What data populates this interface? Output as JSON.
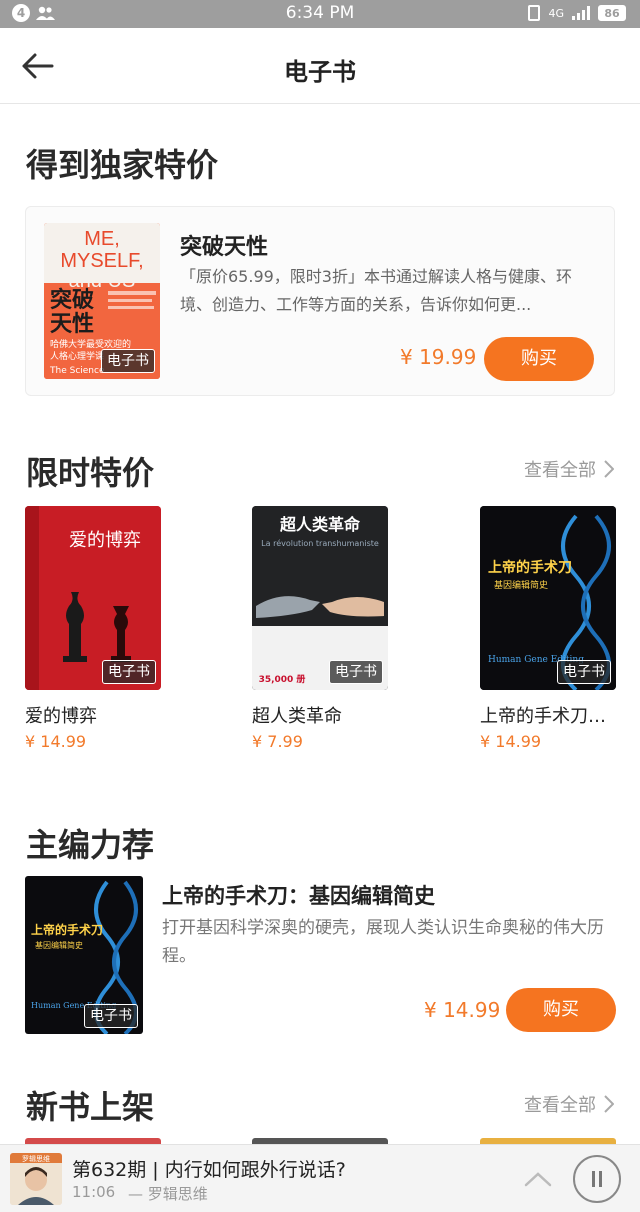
{
  "status_bar": {
    "badge": "4",
    "time": "6:34 PM",
    "network": "4G",
    "battery": "86"
  },
  "nav": {
    "title": "电子书"
  },
  "exclusive": {
    "section_title": "得到独家特价",
    "book": {
      "title": "突破天性",
      "description": "「原价65.99，限时3折」本书通过解读人格与健康、环境、创造力、工作等方面的关系，告诉你如何更...",
      "price": "¥ 19.99",
      "buy_label": "购买",
      "tag": "电子书",
      "cover": {
        "line1": "ME,",
        "line2": "MYSELF,",
        "line3": "and US",
        "cn_title": "突破\n天性",
        "subtitle": "哈佛大学最受欢迎的\n人格心理学课",
        "en": "The Science\nand the Art of"
      }
    }
  },
  "limited": {
    "section_title": "限时特价",
    "see_all": "查看全部",
    "books": [
      {
        "title": "爱的博弈",
        "price": "¥ 14.99",
        "tag": "电子书",
        "cover_title": "爱的博弈"
      },
      {
        "title": "超人类革命",
        "price": "¥ 7.99",
        "tag": "电子书",
        "cover_title": "超人类革命",
        "cover_sub": "La révolution transhumaniste",
        "cover_num": "35,000 册"
      },
      {
        "title": "上帝的手术刀：基因编辑简史",
        "price": "¥ 14.99",
        "tag": "电子书",
        "cover_title": "上帝的手术刀",
        "cover_sub": "基因编辑简史",
        "cover_en": "Human Gene Editing"
      }
    ]
  },
  "editor_pick": {
    "section_title": "主编力荐",
    "book": {
      "title": "上帝的手术刀：基因编辑简史",
      "description": "打开基因科学深奥的硬壳，展现人类认识生命奥秘的伟大历程。",
      "price": "¥ 14.99",
      "buy_label": "购买",
      "tag": "电子书",
      "cover_title": "上帝的手术刀",
      "cover_sub": "基因编辑简史",
      "cover_en": "Human Gene Editing"
    }
  },
  "new_books": {
    "section_title": "新书上架",
    "see_all": "查看全部"
  },
  "player": {
    "thumb_label": "罗辑思维",
    "title": "第632期 | 内行如何跟外行说话?",
    "time": "11:06",
    "author": "— 罗辑思维"
  },
  "colors": {
    "accent": "#f57420",
    "price": "#f27a2b"
  }
}
